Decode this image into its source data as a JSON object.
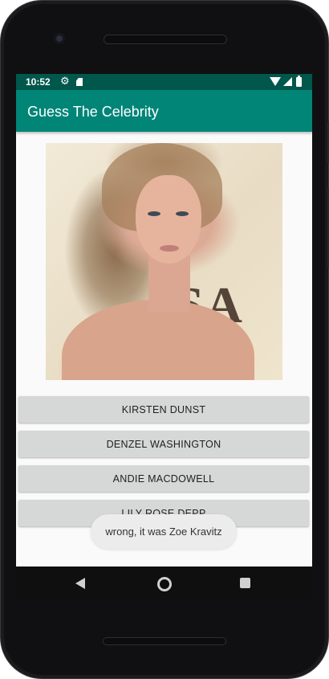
{
  "status_bar": {
    "time": "10:52",
    "icons": [
      "gear-icon",
      "sd-card-icon",
      "wifi-icon",
      "signal-icon",
      "battery-icon"
    ]
  },
  "app_bar": {
    "title": "Guess The Celebrity",
    "color": "#008577",
    "status_color": "#00574b"
  },
  "celebrity_image": {
    "icon": "celebrity-photo"
  },
  "answers": [
    {
      "label": "KIRSTEN DUNST"
    },
    {
      "label": "DENZEL WASHINGTON"
    },
    {
      "label": "ANDIE MACDOWELL"
    },
    {
      "label": "LILY ROSE DEPP"
    }
  ],
  "toast": {
    "message": "wrong, it was Zoe Kravitz"
  },
  "nav_bar": {
    "icons": [
      "back-icon",
      "home-icon",
      "recents-icon"
    ]
  }
}
